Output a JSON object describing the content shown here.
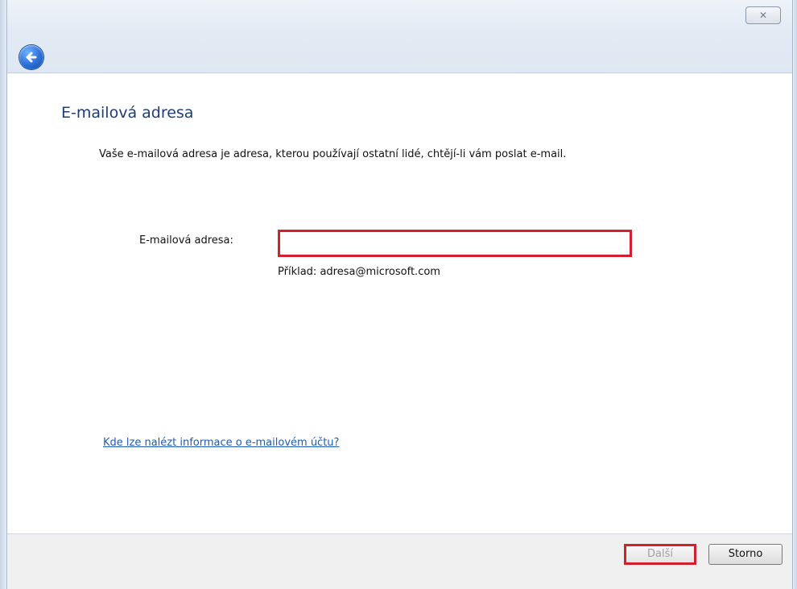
{
  "window": {
    "close_symbol": "✕"
  },
  "page": {
    "title": "E-mailová adresa",
    "description": "Vaše e-mailová adresa je adresa, kterou používají ostatní lidé, chtějí-li vám poslat e-mail."
  },
  "form": {
    "email_label": "E-mailová adresa:",
    "email_value": "",
    "example": "Příklad: adresa@microsoft.com"
  },
  "help_link": "Kde lze nalézt informace o e-mailovém účtu?",
  "buttons": {
    "next": "Další",
    "cancel": "Storno"
  },
  "colors": {
    "highlight": "#d3202f",
    "title": "#1e3c78",
    "link": "#1f5bb5"
  },
  "icons": {
    "back": "back-arrow-icon",
    "close": "close-icon"
  }
}
